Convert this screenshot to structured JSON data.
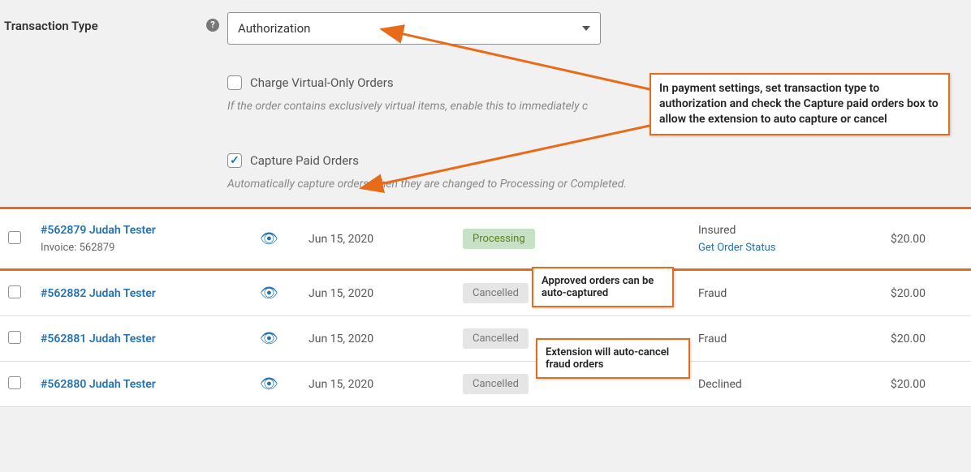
{
  "settings": {
    "transaction_type_label": "Transaction Type",
    "transaction_type_value": "Authorization",
    "help_glyph": "?",
    "charge_virtual": {
      "label": "Charge Virtual-Only Orders",
      "desc": "If the order contains exclusively virtual items, enable this to immediately c",
      "checked": false
    },
    "capture_paid": {
      "label": "Capture Paid Orders",
      "desc": "Automatically capture orders when they are changed to Processing or Completed.",
      "checked": true
    }
  },
  "callouts": {
    "main": "In payment settings, set transaction type to authorization and check the Capture paid orders box to allow the extension to auto capture or cancel",
    "approved": "Approved orders can be auto-captured",
    "fraud": "Extension will auto-cancel fraud orders"
  },
  "orders": [
    {
      "link": "#562879 Judah Tester",
      "sub": "Invoice: 562879",
      "date": "Jun 15, 2020",
      "status": "Processing",
      "status_class": "processing",
      "fraud": "Insured",
      "get_status": "Get Order Status",
      "amount": "$20.00",
      "highlight": true
    },
    {
      "link": "#562882 Judah Tester",
      "sub": "",
      "date": "Jun 15, 2020",
      "status": "Cancelled",
      "status_class": "cancelled",
      "fraud": "Fraud",
      "get_status": "",
      "amount": "$20.00",
      "highlight": false
    },
    {
      "link": "#562881 Judah Tester",
      "sub": "",
      "date": "Jun 15, 2020",
      "status": "Cancelled",
      "status_class": "cancelled",
      "fraud": "Fraud",
      "get_status": "",
      "amount": "$20.00",
      "highlight": false
    },
    {
      "link": "#562880 Judah Tester",
      "sub": "",
      "date": "Jun 15, 2020",
      "status": "Cancelled",
      "status_class": "cancelled",
      "fraud": "Declined",
      "get_status": "",
      "amount": "$20.00",
      "highlight": false
    }
  ],
  "eye_glyph": "👁"
}
